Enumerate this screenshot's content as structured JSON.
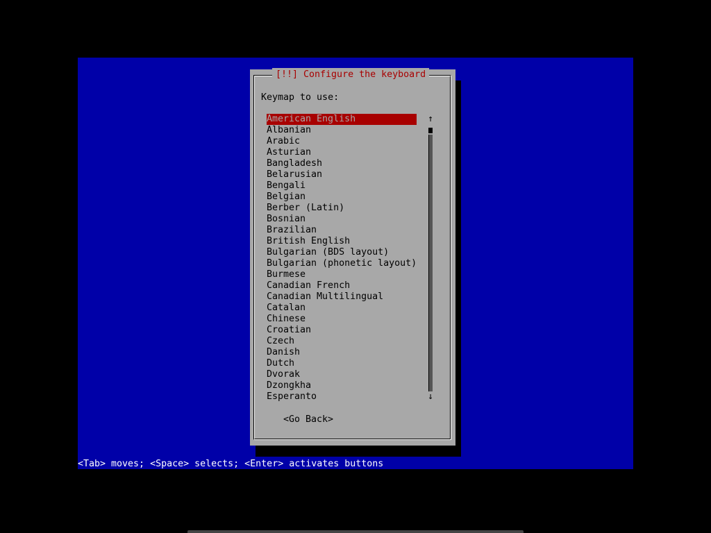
{
  "dialog": {
    "title": "[!!] Configure the keyboard",
    "prompt": "Keymap to use:",
    "back_button": "<Go Back>"
  },
  "keymaps": [
    "American English",
    "Albanian",
    "Arabic",
    "Asturian",
    "Bangladesh",
    "Belarusian",
    "Bengali",
    "Belgian",
    "Berber (Latin)",
    "Bosnian",
    "Brazilian",
    "British English",
    "Bulgarian (BDS layout)",
    "Bulgarian (phonetic layout)",
    "Burmese",
    "Canadian French",
    "Canadian Multilingual",
    "Catalan",
    "Chinese",
    "Croatian",
    "Czech",
    "Danish",
    "Dutch",
    "Dvorak",
    "Dzongkha",
    "Esperanto"
  ],
  "selected_keymap": "American English",
  "scrollbar": {
    "up_arrow": "↑",
    "down_arrow": "↓"
  },
  "help_text": "<Tab> moves; <Space> selects; <Enter> activates buttons",
  "colors": {
    "screen_bg": "#0000a8",
    "dialog_bg": "#a8a8a8",
    "title_text": "#a80000",
    "selection_bg": "#a80000"
  }
}
